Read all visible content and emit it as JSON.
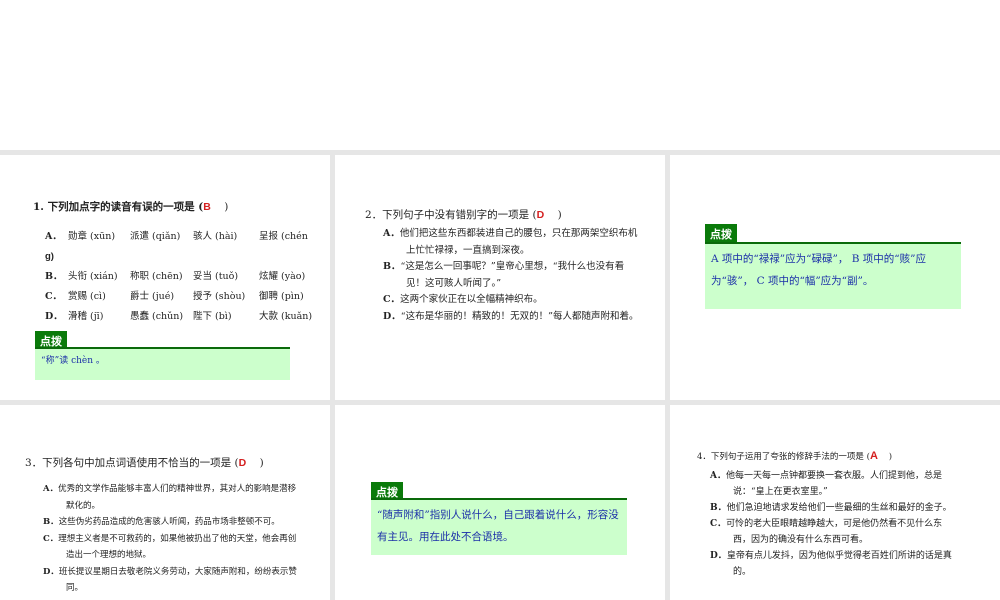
{
  "slides": [
    {
      "question": "1. 下列加点字的读音有误的一项是 (",
      "answer": "B",
      "close": ")",
      "options": [
        {
          "label": "A．",
          "items": [
            "勋章 (xūn)",
            "派遣 (qiǎn)",
            "骇人 (hài)",
            "呈报 (chén"
          ],
          "cont": "g)"
        },
        {
          "label": "B．",
          "items": [
            "头衔 (xián)",
            "称职 (chēn)",
            "妥当 (tuǒ)",
            "炫耀 (yào)"
          ]
        },
        {
          "label": "C．",
          "items": [
            "赏赐 (cì)",
            "爵士 (jué)",
            "授予 (shòu)",
            "御聘 (pìn)"
          ]
        },
        {
          "label": "D．",
          "items": [
            "滑稽 (jī)",
            "愚蠢 (chǔn)",
            "陛下 (bì)",
            "大款 (kuǎn)"
          ]
        }
      ],
      "tip_label": "点拨",
      "tip": "“称”读 chèn 。"
    },
    {
      "question": "2．下列句子中没有错别字的一项是 (",
      "answer": "D",
      "close": ")",
      "options": [
        {
          "label": "A．",
          "text": "他们把这些东西都装进自己的腰包，只在那两架空织布机上忙忙禄禄，一直搞到深夜。"
        },
        {
          "label": "B．",
          "text": "“这是怎么一回事呢？”皇帝心里想，“我什么也没有看见！这可赅人听闻了。”"
        },
        {
          "label": "C．",
          "text": "这两个家伙正在以全幅精神织布。"
        },
        {
          "label": "D．",
          "text": "“这布是华丽的！精致的！无双的！”每人都随声附和着。"
        }
      ]
    },
    {
      "tip_label": "点拨",
      "tip": "A 项中的“禄禄”应为“碌碌”， B 项中的“赅”应为“骇”， C 项中的“幅”应为“副”。"
    },
    {
      "question": "3．下列各句中加点词语使用不恰当的一项是 (",
      "answer": "D",
      "close": ")",
      "options": [
        {
          "label": "A．",
          "text": "优秀的文学作品能够丰富人们的精神世界，其对人的影响是潜移默化的。"
        },
        {
          "label": "B．",
          "text": "这些伪劣药品造成的危害骇人听闻，药品市场非整顿不可。"
        },
        {
          "label": "C．",
          "text": "理想主义者是不可救药的，如果他被扔出了他的天堂，他会再创造出一个理想的地狱。"
        },
        {
          "label": "D．",
          "text": "班长提议星期日去敬老院义务劳动，大家随声附和，纷纷表示赞同。"
        }
      ]
    },
    {
      "tip_label": "点拨",
      "tip": "“随声附和”指别人说什么，自己跟着说什么，形容没有主见。用在此处不合语境。"
    },
    {
      "question": "4．下列句子运用了夸张的修辞手法的一项是 (",
      "answer": "A",
      "close": ")",
      "options": [
        {
          "label": "A．",
          "text": "他每一天每一点钟都要换一套衣服。人们提到他，总是说：“皇上在更衣室里。”"
        },
        {
          "label": "B．",
          "text": "他们急迫地请求发给他们一些最细的生丝和最好的金子。"
        },
        {
          "label": "C．",
          "text": "可怜的老大臣眼睛越睁越大，可是他仍然看不见什么东西，因为的确没有什么东西可看。"
        },
        {
          "label": "D．",
          "text": "皇帝有点儿发抖，因为他似乎觉得老百姓们所讲的话是真的。"
        }
      ]
    }
  ]
}
